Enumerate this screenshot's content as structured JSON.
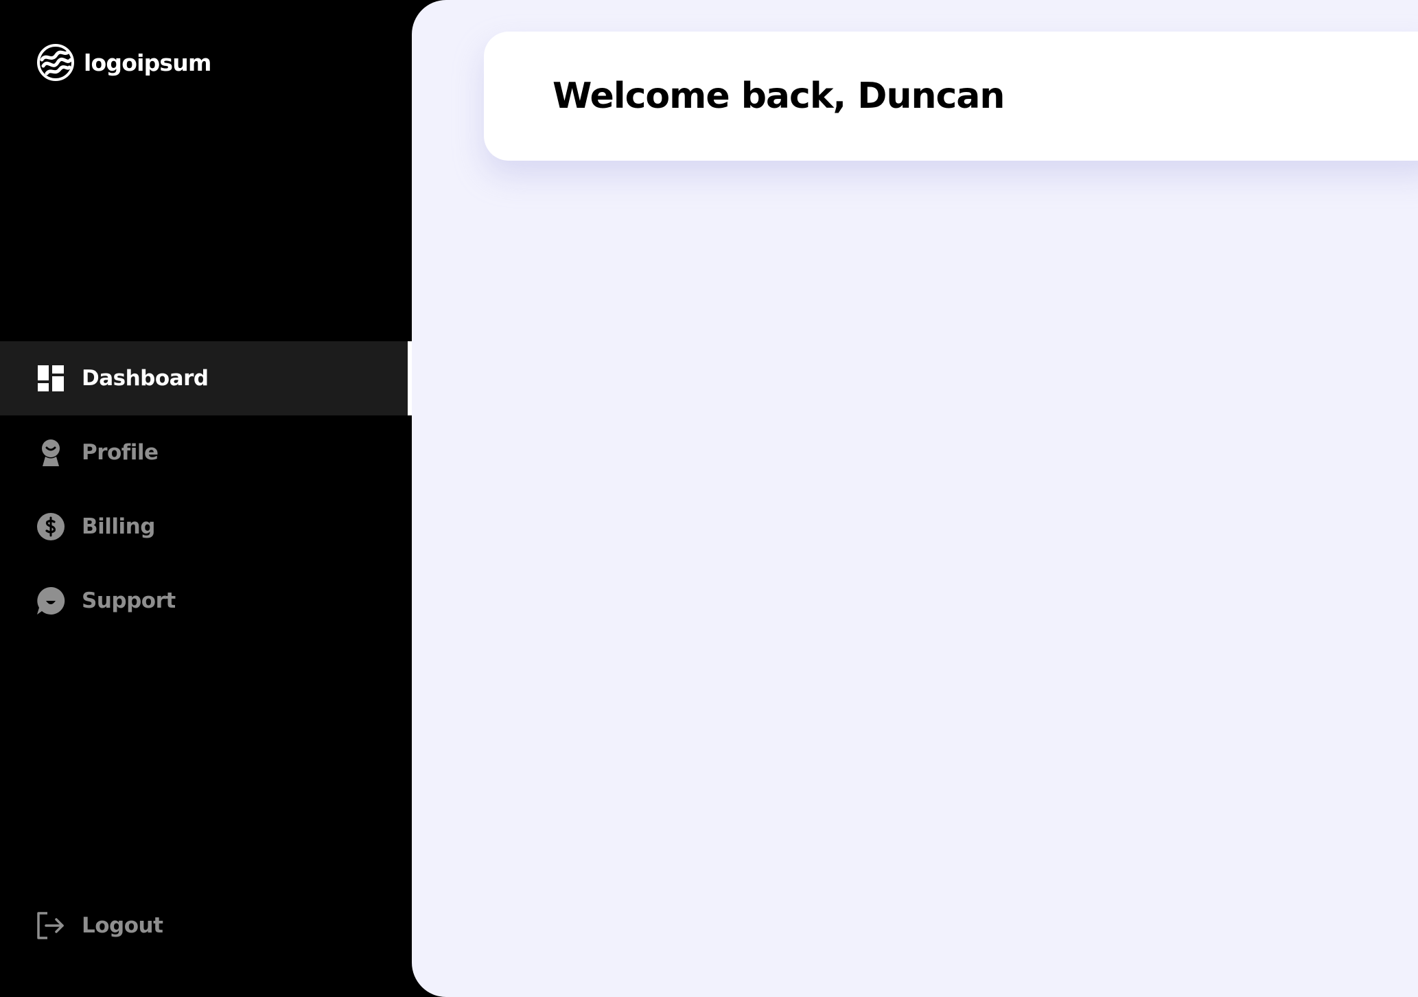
{
  "brand": {
    "name": "logoipsum",
    "logo_icon": "logo-mark-icon"
  },
  "sidebar": {
    "items": [
      {
        "label": "Dashboard",
        "icon": "dashboard-icon",
        "active": true
      },
      {
        "label": "Profile",
        "icon": "profile-icon",
        "active": false
      },
      {
        "label": "Billing",
        "icon": "billing-icon",
        "active": false
      },
      {
        "label": "Support",
        "icon": "support-icon",
        "active": false
      }
    ],
    "logout": {
      "label": "Logout",
      "icon": "logout-icon"
    }
  },
  "main": {
    "welcome_title": "Welcome back, Duncan"
  },
  "colors": {
    "sidebar_bg": "#000000",
    "active_item_bg": "#1c1c1c",
    "active_text": "#ffffff",
    "inactive_text": "#8f8f8f",
    "main_bg": "#f2f2fd",
    "card_bg": "#ffffff"
  }
}
